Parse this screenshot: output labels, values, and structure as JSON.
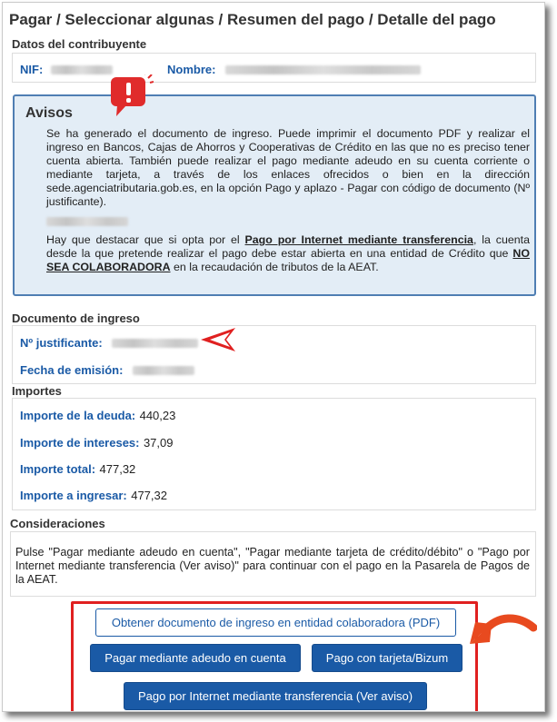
{
  "header": {
    "title": "Pagar / Seleccionar algunas / Resumen del pago / Detalle del pago"
  },
  "contribuyente": {
    "section_title": "Datos del contribuyente",
    "nif_label": "NIF:",
    "nombre_label": "Nombre:"
  },
  "avisos": {
    "title": "Avisos",
    "paragraph1": "Se ha generado el documento de ingreso. Puede imprimir el documento PDF y realizar el ingreso en Bancos, Cajas de Ahorros y Cooperativas de Crédito en las que no es preciso tener cuenta abierta. También puede realizar el pago mediante adeudo en su cuenta corriente o mediante tarjeta, a través de los enlaces ofrecidos o bien en la dirección sede.agenciatributaria.gob.es, en la opción Pago y aplazo - Pagar con código de documento (Nº justificante).",
    "p3_before": "Hay que destacar que si opta por el ",
    "p3_link": "Pago por Internet mediante transferencia",
    "p3_middle": ", la cuenta desde la que pretende realizar el pago debe estar abierta en una entidad de Crédito que ",
    "p3_strong": "NO SEA COLABORADORA",
    "p3_after": " en la recaudación de tributos de la AEAT."
  },
  "documento": {
    "section_title": "Documento de ingreso",
    "justificante_label": "Nº justificante:",
    "fecha_label": "Fecha de emisión:"
  },
  "importes": {
    "section_title": "Importes",
    "deuda_label": "Importe de la deuda:",
    "deuda_value": "440,23",
    "intereses_label": "Importe de intereses:",
    "intereses_value": "37,09",
    "total_label": "Importe total:",
    "total_value": "477,32",
    "ingresar_label": "Importe a ingresar:",
    "ingresar_value": "477,32"
  },
  "consideraciones": {
    "section_title": "Consideraciones",
    "text": "Pulse \"Pagar mediante adeudo en cuenta\", \"Pagar mediante tarjeta de crédito/débito\" o \"Pago por Internet mediante transferencia (Ver aviso)\" para continuar con el pago en la Pasarela de Pagos de la AEAT."
  },
  "buttons": {
    "pdf": "Obtener documento de ingreso en entidad colaboradora (PDF)",
    "adeudo": "Pagar mediante adeudo en cuenta",
    "tarjeta": "Pago con tarjeta/Bizum",
    "transferencia": "Pago por Internet mediante transferencia (Ver aviso)"
  },
  "colors": {
    "accent_blue": "#1a5aa6",
    "avisos_bg": "#e3edf6",
    "avisos_border": "#4f7eb3",
    "highlight_red": "#e02020"
  },
  "icons": {
    "alert": "exclamation-speech-bubble-icon",
    "pointer": "left-arrow-icon",
    "curved_arrow": "curved-arrow-icon"
  }
}
